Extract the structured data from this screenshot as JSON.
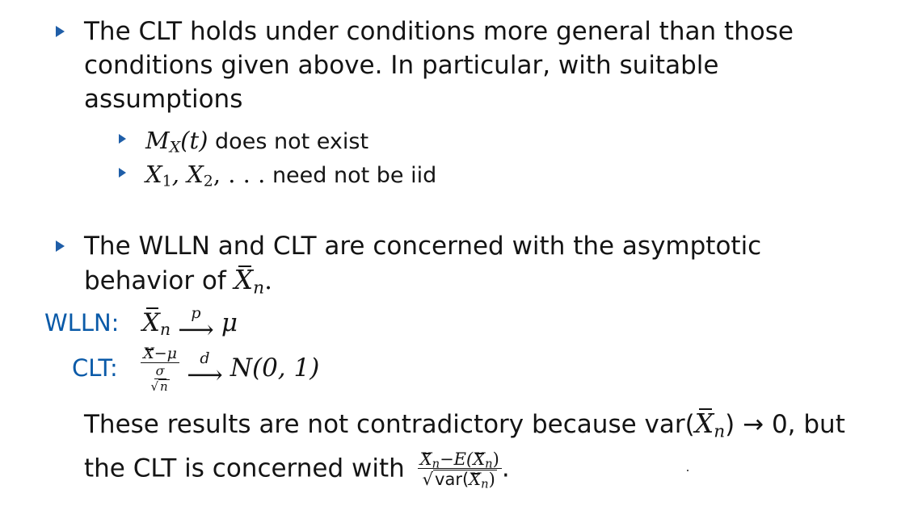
{
  "bullet1": {
    "lines": [
      "The CLT holds under conditions more general than those",
      "conditions given above. In particular, with suitable",
      "assumptions"
    ],
    "sub1_math": "M",
    "sub1_subscript": "X",
    "sub1_arg": "(t)",
    "sub1_text": "does not exist",
    "sub2_math": "X",
    "sub2_sub1": "1",
    "sub2_sep": ", ",
    "sub2_sub2": "2",
    "sub2_tail": ", . . .",
    "sub2_text": "need not be iid"
  },
  "bullet2": {
    "line1": "The WLLN and CLT are concerned with the asymptotic",
    "line2_prefix": "behavior of",
    "line2_math": "X",
    "line2_sub": "n",
    "line2_end": "."
  },
  "wlln": {
    "label": "WLLN:",
    "lhs": "X",
    "lhs_sub": "n",
    "arrow_label": "p",
    "rhs": "μ"
  },
  "clt": {
    "label": "CLT:",
    "num_x": "X",
    "num_rest": "−μ",
    "den_sigma": "σ",
    "den_n": "n",
    "arrow_label": "d",
    "rhs": "N(0, 1)"
  },
  "conclusion": {
    "line1_prefix": "These results are not contradictory because var(",
    "line1_math": "X",
    "line1_sub": "n",
    "line1_suffix": ") → 0, but",
    "line2_prefix": "the CLT is concerned with",
    "frac_num": "X",
    "frac_num_sub": "n",
    "frac_num_mid": "−E(",
    "frac_num_x": "X",
    "frac_num_x_sub": "n",
    "frac_num_end": ")",
    "frac_den_prefix": "var(",
    "frac_den_x": "X",
    "frac_den_sub": "n",
    "frac_den_end": ")",
    "line2_end": "."
  },
  "colors": {
    "accent": "#1f5ea8",
    "label": "#0a5aa8",
    "text": "#141414"
  }
}
